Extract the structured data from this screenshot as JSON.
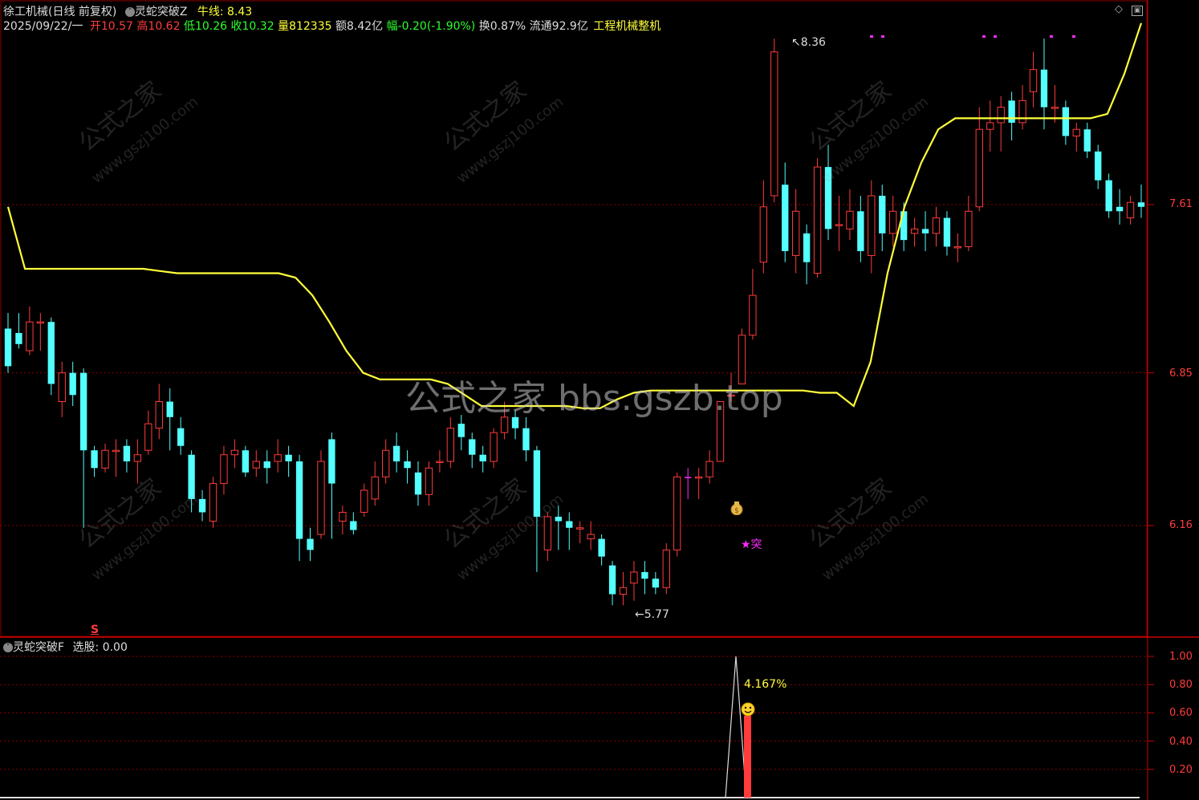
{
  "header": {
    "stock_name": "徐工机械(日线 前复权)",
    "indicator_main": "灵蛇突破Z",
    "niuxian_label": "牛线:",
    "niuxian_value": "8.43",
    "date": "2025/09/22/一",
    "open_label": "开",
    "open_value": "10.57",
    "high_label": "高",
    "high_value": "10.62",
    "low_label": "低",
    "low_value": "10.26",
    "close_label": "收",
    "close_value": "10.32",
    "vol_label": "量",
    "vol_value": "812335",
    "amount_label": "额",
    "amount_value": "8.42亿",
    "change_label": "幅",
    "change_value": "-0.20(-1.90%)",
    "turnover_label": "换",
    "turnover_value": "0.87%",
    "float_label": "流通",
    "float_value": "92.9亿",
    "industry": "工程机械整机"
  },
  "sub_header": {
    "indicator_sub": "灵蛇突破F",
    "xuangu_label": "选股:",
    "xuangu_value": "0.00"
  },
  "watermarks": {
    "center": "公式之家 bbs.gszb.top",
    "tile_cn": "公式之家",
    "tile_url": "www.gszj100.com"
  },
  "annotations": {
    "high_mark": "8.36",
    "low_mark": "5.77",
    "tu_label": "★突",
    "pct_label": "4.167%",
    "s_label": "S"
  },
  "icons": {
    "diamond": "diamond-icon",
    "window": "window-icon",
    "money_bag": "money-bag-icon",
    "smiley": "smiley-icon"
  },
  "colors": {
    "up": "#ff3b3b",
    "down": "#54ffff",
    "yellow_line": "#ffff3a",
    "magenta": "#ff2cff",
    "grid": "#8b0000",
    "axis_label": "#ff3b3b"
  },
  "chart_data": [
    {
      "type": "candlestick",
      "title": "灵蛇突破Z",
      "y_ticks": [
        7.61,
        6.85,
        6.16
      ],
      "ylim": [
        5.6,
        8.45
      ],
      "candles": [
        [
          7.05,
          6.88,
          7.12,
          6.85
        ],
        [
          7.03,
          6.98,
          7.12,
          6.96
        ],
        [
          6.95,
          7.08,
          7.15,
          6.93
        ],
        [
          7.08,
          7.08,
          7.12,
          6.95
        ],
        [
          7.08,
          6.8,
          7.1,
          6.75
        ],
        [
          6.72,
          6.85,
          6.9,
          6.65
        ],
        [
          6.85,
          6.75,
          6.9,
          6.7
        ],
        [
          6.85,
          6.5,
          6.87,
          6.15
        ],
        [
          6.5,
          6.42,
          6.52,
          6.38
        ],
        [
          6.42,
          6.5,
          6.53,
          6.4
        ],
        [
          6.5,
          6.5,
          6.55,
          6.38
        ],
        [
          6.52,
          6.45,
          6.55,
          6.4
        ],
        [
          6.45,
          6.48,
          6.55,
          6.35
        ],
        [
          6.5,
          6.62,
          6.68,
          6.48
        ],
        [
          6.6,
          6.72,
          6.8,
          6.55
        ],
        [
          6.72,
          6.65,
          6.78,
          6.5
        ],
        [
          6.6,
          6.52,
          6.65,
          6.48
        ],
        [
          6.48,
          6.28,
          6.5,
          6.22
        ],
        [
          6.28,
          6.22,
          6.32,
          6.18
        ],
        [
          6.18,
          6.35,
          6.38,
          6.15
        ],
        [
          6.35,
          6.48,
          6.52,
          6.3
        ],
        [
          6.48,
          6.5,
          6.55,
          6.42
        ],
        [
          6.5,
          6.4,
          6.52,
          6.38
        ],
        [
          6.42,
          6.45,
          6.5,
          6.38
        ],
        [
          6.45,
          6.42,
          6.5,
          6.35
        ],
        [
          6.45,
          6.48,
          6.55,
          6.4
        ],
        [
          6.48,
          6.45,
          6.52,
          6.38
        ],
        [
          6.45,
          6.1,
          6.48,
          6.0
        ],
        [
          6.1,
          6.05,
          6.15,
          6.0
        ],
        [
          6.12,
          6.45,
          6.5,
          6.1
        ],
        [
          6.55,
          6.35,
          6.58,
          6.1
        ],
        [
          6.18,
          6.22,
          6.25,
          6.12
        ],
        [
          6.18,
          6.14,
          6.22,
          6.12
        ],
        [
          6.22,
          6.32,
          6.35,
          6.2
        ],
        [
          6.28,
          6.38,
          6.45,
          6.25
        ],
        [
          6.38,
          6.5,
          6.55,
          6.35
        ],
        [
          6.52,
          6.45,
          6.58,
          6.4
        ],
        [
          6.45,
          6.42,
          6.5,
          6.35
        ],
        [
          6.4,
          6.3,
          6.45,
          6.25
        ],
        [
          6.3,
          6.42,
          6.45,
          6.25
        ],
        [
          6.45,
          6.45,
          6.5,
          6.4
        ],
        [
          6.45,
          6.6,
          6.65,
          6.42
        ],
        [
          6.62,
          6.56,
          6.66,
          6.5
        ],
        [
          6.55,
          6.48,
          6.58,
          6.42
        ],
        [
          6.48,
          6.45,
          6.52,
          6.4
        ],
        [
          6.45,
          6.58,
          6.6,
          6.42
        ],
        [
          6.58,
          6.65,
          6.72,
          6.55
        ],
        [
          6.65,
          6.6,
          6.68,
          6.55
        ],
        [
          6.6,
          6.5,
          6.65,
          6.45
        ],
        [
          6.5,
          6.2,
          6.52,
          5.95
        ],
        [
          6.05,
          6.2,
          6.22,
          6.0
        ],
        [
          6.2,
          6.18,
          6.25,
          6.05
        ],
        [
          6.18,
          6.15,
          6.22,
          6.05
        ],
        [
          6.15,
          6.15,
          6.18,
          6.08
        ],
        [
          6.1,
          6.12,
          6.18,
          6.05
        ],
        [
          6.1,
          6.02,
          6.12,
          5.98
        ],
        [
          5.98,
          5.85,
          6.0,
          5.8
        ],
        [
          5.85,
          5.88,
          5.95,
          5.8
        ],
        [
          5.9,
          5.95,
          6.0,
          5.82
        ],
        [
          5.95,
          5.92,
          6.0,
          5.85
        ],
        [
          5.92,
          5.88,
          5.95,
          5.85
        ],
        [
          5.88,
          6.05,
          6.08,
          5.85
        ],
        [
          6.05,
          6.38,
          6.4,
          6.02
        ],
        [
          6.38,
          6.38,
          6.42,
          6.28
        ],
        [
          6.38,
          6.38,
          6.42,
          6.28
        ],
        [
          6.38,
          6.45,
          6.5,
          6.35
        ],
        [
          6.45,
          6.72,
          6.72,
          6.45
        ],
        [
          6.75,
          6.75,
          6.85,
          6.72
        ],
        [
          6.8,
          7.02,
          7.05,
          6.8
        ],
        [
          7.02,
          7.2,
          7.32,
          7.0
        ],
        [
          7.35,
          7.6,
          7.72,
          7.3
        ],
        [
          7.65,
          8.3,
          8.36,
          7.62
        ],
        [
          7.7,
          7.4,
          7.8,
          7.35
        ],
        [
          7.38,
          7.58,
          7.68,
          7.3
        ],
        [
          7.48,
          7.35,
          7.52,
          7.25
        ],
        [
          7.3,
          7.78,
          7.82,
          7.28
        ],
        [
          7.78,
          7.5,
          7.88,
          7.45
        ],
        [
          7.52,
          7.52,
          7.65,
          7.4
        ],
        [
          7.5,
          7.58,
          7.68,
          7.45
        ],
        [
          7.58,
          7.4,
          7.65,
          7.35
        ],
        [
          7.38,
          7.65,
          7.72,
          7.3
        ],
        [
          7.65,
          7.48,
          7.7,
          7.4
        ],
        [
          7.48,
          7.58,
          7.65,
          7.42
        ],
        [
          7.58,
          7.45,
          7.62,
          7.4
        ],
        [
          7.48,
          7.5,
          7.55,
          7.42
        ],
        [
          7.5,
          7.48,
          7.58,
          7.4
        ],
        [
          7.48,
          7.55,
          7.6,
          7.42
        ],
        [
          7.55,
          7.42,
          7.58,
          7.38
        ],
        [
          7.42,
          7.42,
          7.48,
          7.35
        ],
        [
          7.42,
          7.58,
          7.65,
          7.4
        ],
        [
          7.6,
          7.95,
          8.05,
          7.58
        ],
        [
          7.95,
          7.98,
          8.08,
          7.85
        ],
        [
          7.98,
          8.05,
          8.1,
          7.85
        ],
        [
          8.08,
          7.98,
          8.12,
          7.9
        ],
        [
          7.98,
          8.08,
          8.15,
          7.95
        ],
        [
          8.12,
          8.22,
          8.3,
          8.05
        ],
        [
          8.22,
          8.05,
          8.36,
          7.95
        ],
        [
          8.05,
          8.05,
          8.15,
          7.98
        ],
        [
          8.05,
          7.92,
          8.08,
          7.88
        ],
        [
          7.92,
          7.95,
          7.98,
          7.85
        ],
        [
          7.95,
          7.85,
          7.98,
          7.82
        ],
        [
          7.85,
          7.72,
          7.88,
          7.68
        ],
        [
          7.72,
          7.58,
          7.75,
          7.55
        ],
        [
          7.6,
          7.58,
          7.68,
          7.52
        ],
        [
          7.55,
          7.62,
          7.65,
          7.52
        ],
        [
          7.62,
          7.6,
          7.7,
          7.55
        ]
      ],
      "niuxian_line": [
        7.6,
        7.32,
        7.32,
        7.32,
        7.32,
        7.32,
        7.32,
        7.32,
        7.32,
        7.31,
        7.3,
        7.3,
        7.3,
        7.3,
        7.3,
        7.3,
        7.3,
        7.28,
        7.2,
        7.08,
        6.95,
        6.85,
        6.82,
        6.82,
        6.82,
        6.82,
        6.8,
        6.75,
        6.7,
        6.7,
        6.7,
        6.7,
        6.7,
        6.7,
        6.69,
        6.69,
        6.73,
        6.76,
        6.77,
        6.77,
        6.77,
        6.77,
        6.77,
        6.77,
        6.77,
        6.77,
        6.77,
        6.77,
        6.76,
        6.76,
        6.7,
        6.9,
        7.3,
        7.6,
        7.8,
        7.95,
        8.0,
        8.0,
        8.0,
        8.0,
        8.0,
        8.0,
        8.0,
        8.0,
        8.0,
        8.02,
        8.2,
        8.43
      ],
      "breakout_bar_index": 63,
      "high_annotation": {
        "label": "8.36",
        "index": 71
      },
      "low_annotation": {
        "label": "5.77",
        "index": 56
      }
    },
    {
      "type": "line",
      "title": "灵蛇突破F",
      "y_ticks": [
        1.0,
        0.8,
        0.6,
        0.4,
        0.2
      ],
      "ylim": [
        0,
        1.05
      ],
      "peak": {
        "index": 63,
        "value": 1.0,
        "label": "4.167%"
      },
      "bar": {
        "index": 64,
        "value": 0.5
      }
    }
  ]
}
